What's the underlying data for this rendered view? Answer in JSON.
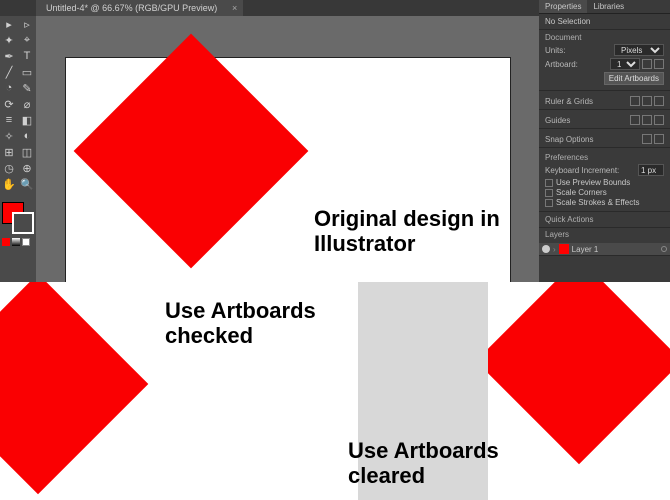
{
  "tab": {
    "title": "Untitled-4* @ 66.67% (RGB/GPU Preview)",
    "close": "×"
  },
  "captions": {
    "main": "Original design in Illustrator",
    "checked_l1": "Use Artboards",
    "checked_l2": "checked",
    "cleared_l1": "Use Artboards",
    "cleared_l2": "cleared"
  },
  "colors": {
    "shape": "#fa0002",
    "panel": "#3a3a3a"
  },
  "panel": {
    "tabs": {
      "properties": "Properties",
      "libraries": "Libraries"
    },
    "noSelection": "No Selection",
    "document": "Document",
    "units": {
      "label": "Units:",
      "value": "Pixels"
    },
    "artboard": {
      "label": "Artboard:",
      "value": "1"
    },
    "editArtboards": "Edit Artboards",
    "rulerGrids": "Ruler & Grids",
    "guides": "Guides",
    "snapOptions": "Snap Options",
    "preferences": "Preferences",
    "keyInc": {
      "label": "Keyboard Increment:",
      "value": "1 px"
    },
    "usePreview": "Use Preview Bounds",
    "scaleCorners": "Scale Corners",
    "scaleStrokes": "Scale Strokes & Effects",
    "quickActions": "Quick Actions",
    "layers": "Layers",
    "layer1": "Layer 1"
  },
  "tools": [
    [
      "▸",
      "▹"
    ],
    [
      "✦",
      "⌖"
    ],
    [
      "✒",
      "T"
    ],
    [
      "╱",
      "▭"
    ],
    [
      "◔",
      "✎"
    ],
    [
      "⟳",
      "⌀"
    ],
    [
      "≡",
      "◧"
    ],
    [
      "✧",
      "◐"
    ],
    [
      "⊞",
      "◫"
    ],
    [
      "◷",
      "⊕"
    ],
    [
      "✋",
      "🔍"
    ]
  ]
}
